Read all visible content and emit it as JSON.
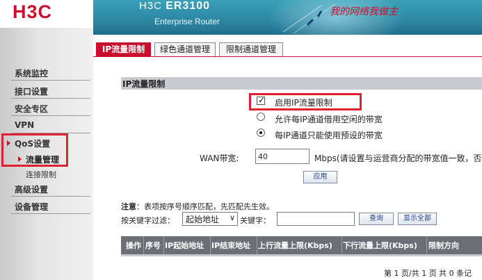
{
  "brand": {
    "logo": "H3C",
    "product": "H3C",
    "model": "ER3100",
    "subtitle": "Enterprise Router",
    "slogan": "我的网络我做主"
  },
  "sidebar": {
    "items": [
      {
        "label": "系统监控"
      },
      {
        "label": "接口设置"
      },
      {
        "label": "安全专区"
      },
      {
        "label": "VPN"
      },
      {
        "label": "QoS设置"
      },
      {
        "label": "高级设置"
      },
      {
        "label": "设备管理"
      }
    ],
    "subitems": [
      {
        "label": "流量管理",
        "active": true
      },
      {
        "label": "连接限制",
        "active": false
      }
    ]
  },
  "tabs": [
    {
      "label": "IP流量限制",
      "active": true
    },
    {
      "label": "绿色通道管理",
      "active": false
    },
    {
      "label": "限制通道管理",
      "active": false
    }
  ],
  "section": {
    "title": "IP流量限制"
  },
  "options": {
    "enable_label": "启用IP流量限制",
    "enable_checked": true,
    "radio_borrow_label": "允许每IP通道借用空闲的带宽",
    "radio_preset_label": "每IP通道只能使用预设的带宽",
    "selected": "preset"
  },
  "wan": {
    "label": "WAN带宽:",
    "value": "40",
    "unit_note": "Mbps(请设置与运营商分配的带宽值一致，否"
  },
  "apply_button": "应用",
  "note": {
    "prefix": "注意",
    "text": "：表项按序号顺序匹配，先匹配先生效。"
  },
  "filter": {
    "label": "按关键字过滤：",
    "select_value": "起始地址",
    "keyword_label": "关键字：",
    "keyword_value": "",
    "query_button": "查询",
    "show_all_button": "显示全部"
  },
  "table": {
    "headers": [
      "操作",
      "序号",
      "IP起始地址",
      "IP结束地址",
      "上行流量上限(Kbps)",
      "下行流量上限(Kbps)",
      "限制方向"
    ]
  },
  "pager": {
    "text": "第 1 页/共 1 页 共 0 条记"
  },
  "colors": {
    "brand_red": "#c8102e",
    "header_teal": "#2c86a2",
    "highlight_red": "#e0202c"
  }
}
